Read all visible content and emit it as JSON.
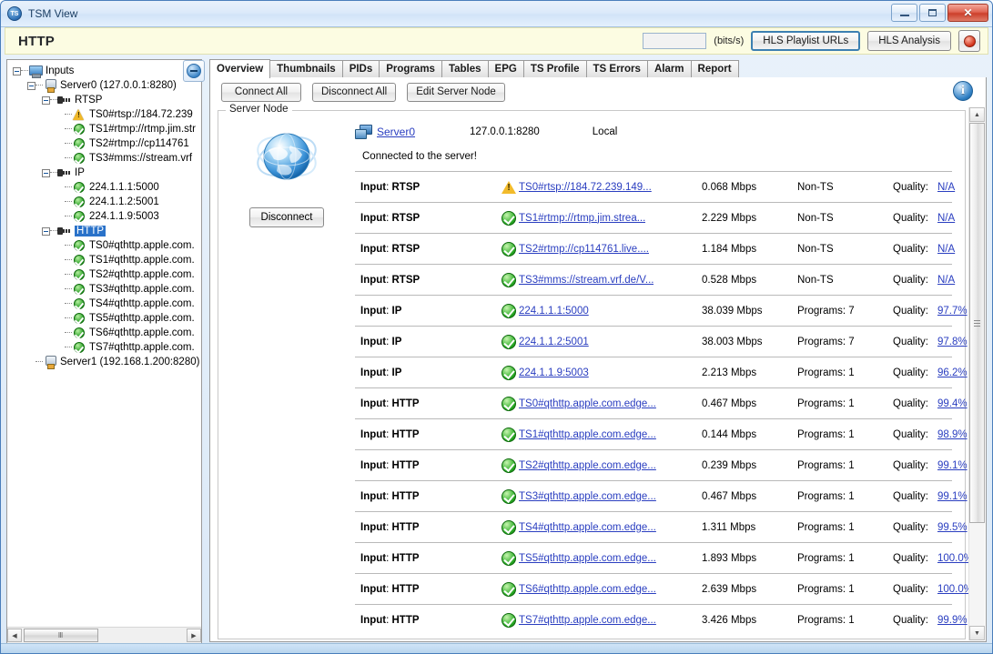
{
  "window": {
    "title": "TSM View",
    "app_icon": "tsm-logo-icon",
    "minimize_label": "Minimize",
    "maximize_label": "Maximize",
    "close_label": "✕"
  },
  "header": {
    "title": "HTTP",
    "rate_value": "",
    "rate_placeholder": "",
    "units_label": "(bits/s)",
    "hls_playlist_button": "HLS Playlist URLs",
    "hls_analysis_button": "HLS Analysis",
    "record_button": "record-button"
  },
  "tree": {
    "nodes": [
      {
        "label": "Inputs",
        "indent": 0,
        "icon": "monitor-icon",
        "expander": true,
        "selected": false
      },
      {
        "label": "Server0 (127.0.0.1:8280)",
        "indent": 1,
        "icon": "server-icon",
        "expander": true,
        "selected": false
      },
      {
        "label": "RTSP",
        "indent": 2,
        "icon": "plug-icon",
        "expander": true,
        "selected": false
      },
      {
        "label": "TS0#rtsp://184.72.239",
        "indent": 3,
        "icon": "warning-icon",
        "expander": false,
        "selected": false
      },
      {
        "label": "TS1#rtmp://rtmp.jim.str",
        "indent": 3,
        "icon": "ok-icon",
        "expander": false,
        "selected": false
      },
      {
        "label": "TS2#rtmp://cp114761",
        "indent": 3,
        "icon": "ok-icon",
        "expander": false,
        "selected": false
      },
      {
        "label": "TS3#mms://stream.vrf",
        "indent": 3,
        "icon": "ok-icon",
        "expander": false,
        "selected": false
      },
      {
        "label": "IP",
        "indent": 2,
        "icon": "plug-icon",
        "expander": true,
        "selected": false
      },
      {
        "label": "224.1.1.1:5000",
        "indent": 3,
        "icon": "ok-icon",
        "expander": false,
        "selected": false
      },
      {
        "label": "224.1.1.2:5001",
        "indent": 3,
        "icon": "ok-icon",
        "expander": false,
        "selected": false
      },
      {
        "label": "224.1.1.9:5003",
        "indent": 3,
        "icon": "ok-icon",
        "expander": false,
        "selected": false
      },
      {
        "label": "HTTP",
        "indent": 2,
        "icon": "plug-icon",
        "expander": true,
        "selected": true
      },
      {
        "label": "TS0#qthttp.apple.com.",
        "indent": 3,
        "icon": "ok-icon",
        "expander": false,
        "selected": false
      },
      {
        "label": "TS1#qthttp.apple.com.",
        "indent": 3,
        "icon": "ok-icon",
        "expander": false,
        "selected": false
      },
      {
        "label": "TS2#qthttp.apple.com.",
        "indent": 3,
        "icon": "ok-icon",
        "expander": false,
        "selected": false
      },
      {
        "label": "TS3#qthttp.apple.com.",
        "indent": 3,
        "icon": "ok-icon",
        "expander": false,
        "selected": false
      },
      {
        "label": "TS4#qthttp.apple.com.",
        "indent": 3,
        "icon": "ok-icon",
        "expander": false,
        "selected": false
      },
      {
        "label": "TS5#qthttp.apple.com.",
        "indent": 3,
        "icon": "ok-icon",
        "expander": false,
        "selected": false
      },
      {
        "label": "TS6#qthttp.apple.com.",
        "indent": 3,
        "icon": "ok-icon",
        "expander": false,
        "selected": false
      },
      {
        "label": "TS7#qthttp.apple.com.",
        "indent": 3,
        "icon": "ok-icon",
        "expander": false,
        "selected": false
      },
      {
        "label": "Server1 (192.168.1.200:8280)",
        "indent": 1,
        "icon": "server-icon",
        "expander": false,
        "selected": false
      }
    ],
    "hscroll": {
      "left_arrow": "◀",
      "right_arrow": "▶",
      "grip": "Ⅲ"
    }
  },
  "collapse_button": {
    "label": "collapse-panel-button"
  },
  "tabs": [
    {
      "label": "Overview",
      "active": true
    },
    {
      "label": "Thumbnails",
      "active": false
    },
    {
      "label": "PIDs",
      "active": false
    },
    {
      "label": "Programs",
      "active": false
    },
    {
      "label": "Tables",
      "active": false
    },
    {
      "label": "EPG",
      "active": false
    },
    {
      "label": "TS Profile",
      "active": false
    },
    {
      "label": "TS Errors",
      "active": false
    },
    {
      "label": "Alarm",
      "active": false
    },
    {
      "label": "Report",
      "active": false
    }
  ],
  "toolbar": {
    "connect_all": "Connect All",
    "disconnect_all": "Disconnect All",
    "edit_server_node": "Edit Server Node",
    "info_icon_label": "i"
  },
  "server_node": {
    "group_title": "Server Node",
    "globe_icon": "globe-icon",
    "name": "Server0",
    "address": "127.0.0.1:8280",
    "location": "Local",
    "connection_message": "Connected to the server!",
    "disconnect_button": "Disconnect"
  },
  "table": {
    "quality_label": "Quality:",
    "rows": [
      {
        "input_label": "Input",
        "input_type": "RTSP",
        "status": "warning-icon",
        "name": "TS0#rtsp://184.72.239.149...",
        "rate": "0.068 Mbps",
        "type": "Non-TS",
        "quality": "N/A"
      },
      {
        "input_label": "Input",
        "input_type": "RTSP",
        "status": "ok-icon",
        "name": "TS1#rtmp://rtmp.jim.strea...",
        "rate": "2.229 Mbps",
        "type": "Non-TS",
        "quality": "N/A"
      },
      {
        "input_label": "Input",
        "input_type": "RTSP",
        "status": "ok-icon",
        "name": "TS2#rtmp://cp114761.live....",
        "rate": "1.184 Mbps",
        "type": "Non-TS",
        "quality": "N/A"
      },
      {
        "input_label": "Input",
        "input_type": "RTSP",
        "status": "ok-icon",
        "name": "TS3#mms://stream.vrf.de/V...",
        "rate": "0.528 Mbps",
        "type": "Non-TS",
        "quality": "N/A"
      },
      {
        "input_label": "Input",
        "input_type": "IP",
        "status": "ok-icon",
        "name": "224.1.1.1:5000",
        "rate": "38.039 Mbps",
        "type": "Programs: 7",
        "quality": "97.7%"
      },
      {
        "input_label": "Input",
        "input_type": "IP",
        "status": "ok-icon",
        "name": "224.1.1.2:5001",
        "rate": "38.003 Mbps",
        "type": "Programs: 7",
        "quality": "97.8%"
      },
      {
        "input_label": "Input",
        "input_type": "IP",
        "status": "ok-icon",
        "name": "224.1.1.9:5003",
        "rate": "2.213 Mbps",
        "type": "Programs: 1",
        "quality": "96.2%"
      },
      {
        "input_label": "Input",
        "input_type": "HTTP",
        "status": "ok-icon",
        "name": "TS0#qthttp.apple.com.edge...",
        "rate": "0.467 Mbps",
        "type": "Programs: 1",
        "quality": "99.4%"
      },
      {
        "input_label": "Input",
        "input_type": "HTTP",
        "status": "ok-icon",
        "name": "TS1#qthttp.apple.com.edge...",
        "rate": "0.144 Mbps",
        "type": "Programs: 1",
        "quality": "98.9%"
      },
      {
        "input_label": "Input",
        "input_type": "HTTP",
        "status": "ok-icon",
        "name": "TS2#qthttp.apple.com.edge...",
        "rate": "0.239 Mbps",
        "type": "Programs: 1",
        "quality": "99.1%"
      },
      {
        "input_label": "Input",
        "input_type": "HTTP",
        "status": "ok-icon",
        "name": "TS3#qthttp.apple.com.edge...",
        "rate": "0.467 Mbps",
        "type": "Programs: 1",
        "quality": "99.1%"
      },
      {
        "input_label": "Input",
        "input_type": "HTTP",
        "status": "ok-icon",
        "name": "TS4#qthttp.apple.com.edge...",
        "rate": "1.311 Mbps",
        "type": "Programs: 1",
        "quality": "99.5%"
      },
      {
        "input_label": "Input",
        "input_type": "HTTP",
        "status": "ok-icon",
        "name": "TS5#qthttp.apple.com.edge...",
        "rate": "1.893 Mbps",
        "type": "Programs: 1",
        "quality": "100.0%"
      },
      {
        "input_label": "Input",
        "input_type": "HTTP",
        "status": "ok-icon",
        "name": "TS6#qthttp.apple.com.edge...",
        "rate": "2.639 Mbps",
        "type": "Programs: 1",
        "quality": "100.0%"
      },
      {
        "input_label": "Input",
        "input_type": "HTTP",
        "status": "ok-icon",
        "name": "TS7#qthttp.apple.com.edge...",
        "rate": "3.426 Mbps",
        "type": "Programs: 1",
        "quality": "99.9%"
      }
    ]
  },
  "scrollbar": {
    "up_arrow": "▲",
    "down_arrow": "▼"
  },
  "colors": {
    "accent_blue": "#3c7fb1",
    "link_blue": "#2a3ec0",
    "header_yellow": "#fcfce2",
    "status_ok_green": "#2fae2a",
    "status_warn_yellow": "#f2bb2b",
    "selection_blue": "#2a72c9",
    "close_red": "#cc3f2b"
  }
}
